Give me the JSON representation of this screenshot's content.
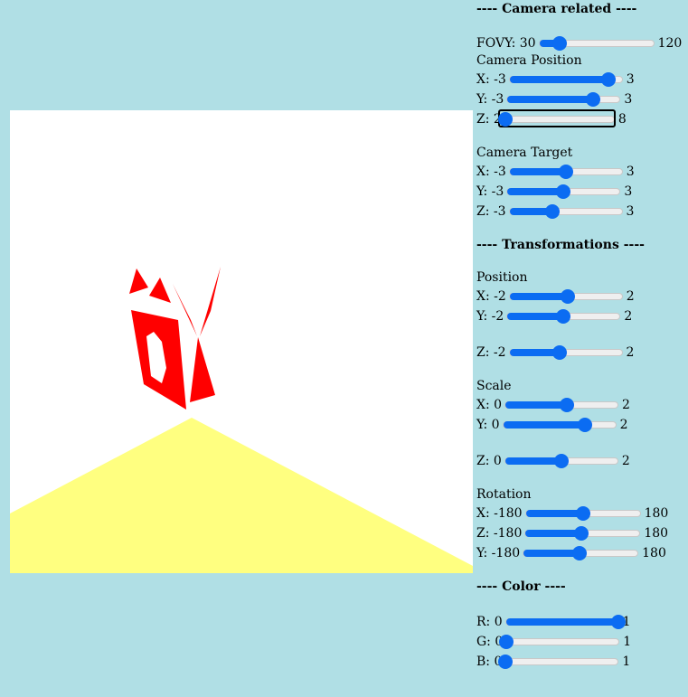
{
  "viewport": {
    "floor_color": "#ffff80",
    "object_color": "#ff0000"
  },
  "camera": {
    "heading": "---- Camera related ----",
    "fovy": {
      "label": "FOVY: 30",
      "max": "120",
      "fraction": 0.18
    },
    "position_label": "Camera Position",
    "position": [
      {
        "label": "X: -3",
        "max": "3",
        "fraction": 0.88
      },
      {
        "label": "Y: -3",
        "max": "3",
        "fraction": 0.76
      },
      {
        "label": "Z: 2",
        "max": "8",
        "fraction": 0.0
      }
    ],
    "target_label": "Camera Target",
    "target": [
      {
        "label": "X: -3",
        "max": "3",
        "fraction": 0.5
      },
      {
        "label": "Y: -3",
        "max": "3",
        "fraction": 0.5
      },
      {
        "label": "Z: -3",
        "max": "3",
        "fraction": 0.38
      }
    ]
  },
  "transformations": {
    "heading": "---- Transformations ----",
    "position_label": "Position",
    "position": [
      {
        "label": "X: -2",
        "max": "2",
        "fraction": 0.52
      },
      {
        "label": "Y: -2",
        "max": "2",
        "fraction": 0.5
      },
      {
        "label": "Z: -2",
        "max": "2",
        "fraction": 0.45
      }
    ],
    "scale_label": "Scale",
    "scale": [
      {
        "label": "X: 0",
        "max": "2",
        "fraction": 0.55
      },
      {
        "label": "Y: 0",
        "max": "2",
        "fraction": 0.73
      },
      {
        "label": "Z: 0",
        "max": "2",
        "fraction": 0.5
      }
    ],
    "rotation_label": "Rotation",
    "rotation": [
      {
        "label": "X: -180",
        "max": "180",
        "fraction": 0.5
      },
      {
        "label": "Z: -180",
        "max": "180",
        "fraction": 0.49
      },
      {
        "label": "Y: -180",
        "max": "180",
        "fraction": 0.49
      }
    ]
  },
  "color": {
    "heading": "---- Color ----",
    "channels": [
      {
        "label": "R: 0",
        "max": "1",
        "fraction": 1.0
      },
      {
        "label": "G: 0",
        "max": "1",
        "fraction": 0.0
      },
      {
        "label": "B: 0",
        "max": "1",
        "fraction": 0.0
      }
    ]
  }
}
